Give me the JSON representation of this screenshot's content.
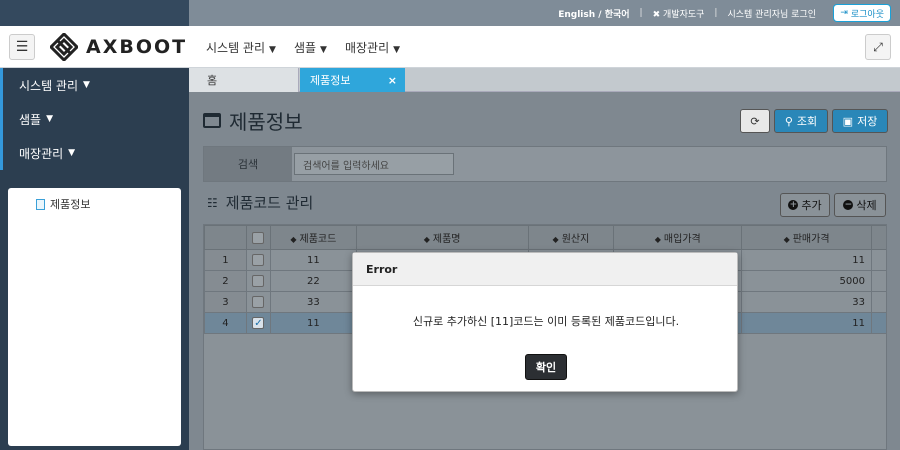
{
  "topbar": {
    "links": [
      "English / 한국어",
      "개발자도구",
      "시스템 관리자님 로그인"
    ],
    "logout_label": "로그아웃"
  },
  "header": {
    "logo_text": "AXBOOT",
    "nav": [
      "시스템 관리",
      "샘플",
      "매장관리"
    ]
  },
  "sidebar": {
    "items": [
      {
        "label": "시스템 관리"
      },
      {
        "label": "샘플"
      },
      {
        "label": "매장관리"
      }
    ],
    "tree": {
      "node_label": "제품정보"
    }
  },
  "tabs": {
    "home_label": "홈",
    "active_label": "제품정보",
    "close_glyph": "×"
  },
  "main": {
    "page_title": "제품정보",
    "toolbar": {
      "search_label": "조회",
      "save_label": "저장"
    },
    "search": {
      "label": "검색",
      "placeholder": "검색어를 입력하세요"
    },
    "section_title": "제품코드 관리",
    "add_label": "추가",
    "delete_label": "삭제",
    "grid": {
      "columns": [
        "제품코드",
        "제품명",
        "원산지",
        "매입가격",
        "판매가격"
      ],
      "rows": [
        {
          "no": "1",
          "checked": false,
          "code": "11",
          "name": "",
          "origin": "",
          "buy": "",
          "sell": "11"
        },
        {
          "no": "2",
          "checked": false,
          "code": "22",
          "name": "",
          "origin": "",
          "buy": "",
          "sell": "5000"
        },
        {
          "no": "3",
          "checked": false,
          "code": "33",
          "name": "",
          "origin": "",
          "buy": "",
          "sell": "33"
        },
        {
          "no": "4",
          "checked": true,
          "code": "11",
          "name": "",
          "origin": "",
          "buy": "",
          "sell": "11"
        }
      ]
    }
  },
  "modal": {
    "title": "Error",
    "message": "신규로 추가하신 [11]코드는 이미 등록된 제품코드입니다.",
    "ok_label": "확인"
  },
  "colors": {
    "accent": "#2fa6db",
    "primary_button": "#2a87b8",
    "sidebar_bg": "#2c3e50"
  }
}
